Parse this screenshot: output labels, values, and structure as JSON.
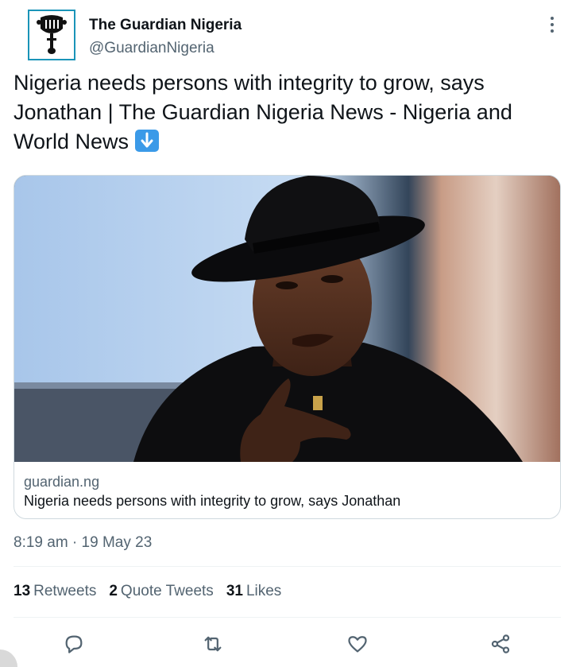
{
  "account": {
    "name": "The Guardian Nigeria",
    "handle": "@GuardianNigeria"
  },
  "tweet": {
    "text": "Nigeria needs persons with integrity to grow, says Jonathan | The Guardian Nigeria News - Nigeria and World News",
    "emoji": "down-arrow-emoji"
  },
  "card": {
    "domain": "guardian.ng",
    "title": "Nigeria needs persons with integrity to grow, says Jonathan",
    "image": "photo of man in black fedora pointing finger"
  },
  "meta": {
    "timestamp": "8:19 am · 19 May 23"
  },
  "stats": {
    "retweets_count": "13",
    "retweets_label": "Retweets",
    "quotes_count": "2",
    "quotes_label": "Quote Tweets",
    "likes_count": "31",
    "likes_label": "Likes"
  },
  "actions": [
    "reply-icon",
    "retweet-icon",
    "like-icon",
    "share-icon"
  ],
  "colors": {
    "accent": "#1d9bf0",
    "text": "#0f1419",
    "secondary": "#536471",
    "border": "#cfd9de",
    "avatar_border": "#1a94b8"
  }
}
